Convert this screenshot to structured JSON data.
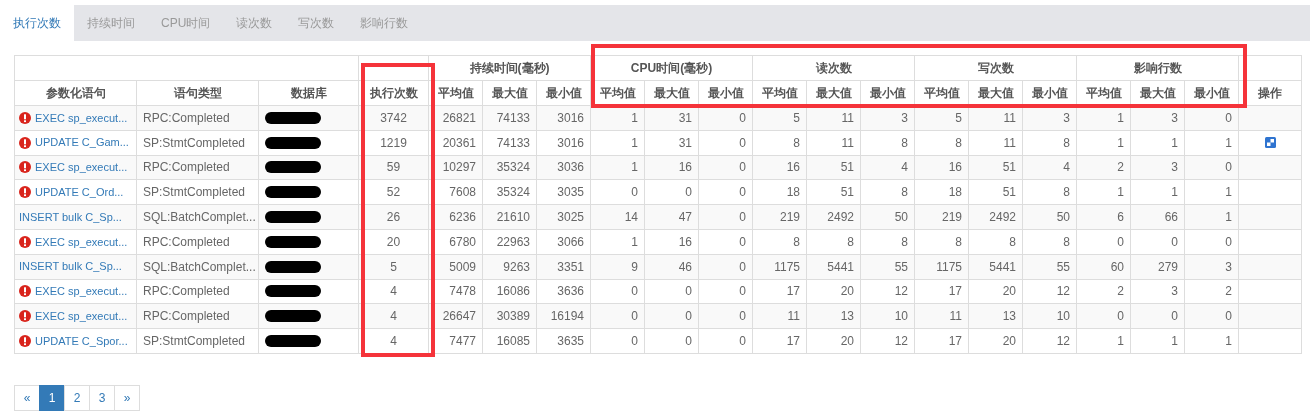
{
  "tabs": [
    {
      "label": "执行次数",
      "selected": true
    },
    {
      "label": "持续时间",
      "selected": false
    },
    {
      "label": "CPU时间",
      "selected": false
    },
    {
      "label": "读次数",
      "selected": false
    },
    {
      "label": "写次数",
      "selected": false
    },
    {
      "label": "影响行数",
      "selected": false
    }
  ],
  "table": {
    "leading_columns": [
      "参数化语句",
      "语句类型",
      "数据库"
    ],
    "count_column": {
      "label": "执行次数",
      "outlined": true
    },
    "groups": [
      {
        "label": "持续时间(毫秒)",
        "outlined": false,
        "columns": [
          "平均值",
          "最大值",
          "最小值"
        ]
      },
      {
        "label": "CPU时间(毫秒)",
        "outlined": true,
        "columns": [
          "平均值",
          "最大值",
          "最小值"
        ]
      },
      {
        "label": "读次数",
        "outlined": true,
        "columns": [
          "平均值",
          "最大值",
          "最小值"
        ]
      },
      {
        "label": "写次数",
        "outlined": true,
        "columns": [
          "平均值",
          "最大值",
          "最小值"
        ]
      },
      {
        "label": "影响行数",
        "outlined": true,
        "columns": [
          "平均值",
          "最大值",
          "最小值"
        ]
      }
    ],
    "action_column": "操作",
    "rows": [
      {
        "statement": "EXEC sp_execut...",
        "warning": true,
        "type": "RPC:Completed",
        "db_redacted": true,
        "count": "3742",
        "values": [
          "26821",
          "74133",
          "3016",
          "1",
          "31",
          "0",
          "5",
          "11",
          "3",
          "5",
          "11",
          "3",
          "1",
          "3",
          "0"
        ],
        "action": false
      },
      {
        "statement": "UPDATE C_Gam...",
        "warning": true,
        "type": "SP:StmtCompleted",
        "db_redacted": true,
        "count": "1219",
        "values": [
          "20361",
          "74133",
          "3016",
          "1",
          "31",
          "0",
          "8",
          "11",
          "8",
          "8",
          "11",
          "8",
          "1",
          "1",
          "1"
        ],
        "action": true
      },
      {
        "statement": "EXEC sp_execut...",
        "warning": true,
        "type": "RPC:Completed",
        "db_redacted": true,
        "count": "59",
        "values": [
          "10297",
          "35324",
          "3036",
          "1",
          "16",
          "0",
          "16",
          "51",
          "4",
          "16",
          "51",
          "4",
          "2",
          "3",
          "0"
        ],
        "action": false
      },
      {
        "statement": "UPDATE C_Ord...",
        "warning": true,
        "type": "SP:StmtCompleted",
        "db_redacted": true,
        "count": "52",
        "values": [
          "7608",
          "35324",
          "3035",
          "0",
          "0",
          "0",
          "18",
          "51",
          "8",
          "18",
          "51",
          "8",
          "1",
          "1",
          "1"
        ],
        "action": false
      },
      {
        "statement": "INSERT bulk C_Sp...",
        "warning": false,
        "type": "SQL:BatchComplet...",
        "db_redacted": true,
        "count": "26",
        "values": [
          "6236",
          "21610",
          "3025",
          "14",
          "47",
          "0",
          "219",
          "2492",
          "50",
          "219",
          "2492",
          "50",
          "6",
          "66",
          "1"
        ],
        "action": false
      },
      {
        "statement": "EXEC sp_execut...",
        "warning": true,
        "type": "RPC:Completed",
        "db_redacted": true,
        "count": "20",
        "values": [
          "6780",
          "22963",
          "3066",
          "1",
          "16",
          "0",
          "8",
          "8",
          "8",
          "8",
          "8",
          "8",
          "0",
          "0",
          "0"
        ],
        "action": false
      },
      {
        "statement": "INSERT bulk C_Sp...",
        "warning": false,
        "type": "SQL:BatchComplet...",
        "db_redacted": true,
        "count": "5",
        "values": [
          "5009",
          "9263",
          "3351",
          "9",
          "46",
          "0",
          "1175",
          "5441",
          "55",
          "1175",
          "5441",
          "55",
          "60",
          "279",
          "3"
        ],
        "action": false
      },
      {
        "statement": "EXEC sp_execut...",
        "warning": true,
        "type": "RPC:Completed",
        "db_redacted": true,
        "count": "4",
        "values": [
          "7478",
          "16086",
          "3636",
          "0",
          "0",
          "0",
          "17",
          "20",
          "12",
          "17",
          "20",
          "12",
          "2",
          "3",
          "2"
        ],
        "action": false
      },
      {
        "statement": "EXEC sp_execut...",
        "warning": true,
        "type": "RPC:Completed",
        "db_redacted": true,
        "count": "4",
        "values": [
          "26647",
          "30389",
          "16194",
          "0",
          "0",
          "0",
          "11",
          "13",
          "10",
          "11",
          "13",
          "10",
          "0",
          "0",
          "0"
        ],
        "action": false
      },
      {
        "statement": "UPDATE C_Spor...",
        "warning": true,
        "type": "SP:StmtCompleted",
        "db_redacted": true,
        "count": "4",
        "values": [
          "7477",
          "16085",
          "3635",
          "0",
          "0",
          "0",
          "17",
          "20",
          "12",
          "17",
          "20",
          "12",
          "1",
          "1",
          "1"
        ],
        "action": false
      }
    ]
  },
  "pagination": [
    {
      "label": "«",
      "selected": false
    },
    {
      "label": "1",
      "selected": true
    },
    {
      "label": "2",
      "selected": false
    },
    {
      "label": "3",
      "selected": false
    },
    {
      "label": "»",
      "selected": false
    }
  ]
}
